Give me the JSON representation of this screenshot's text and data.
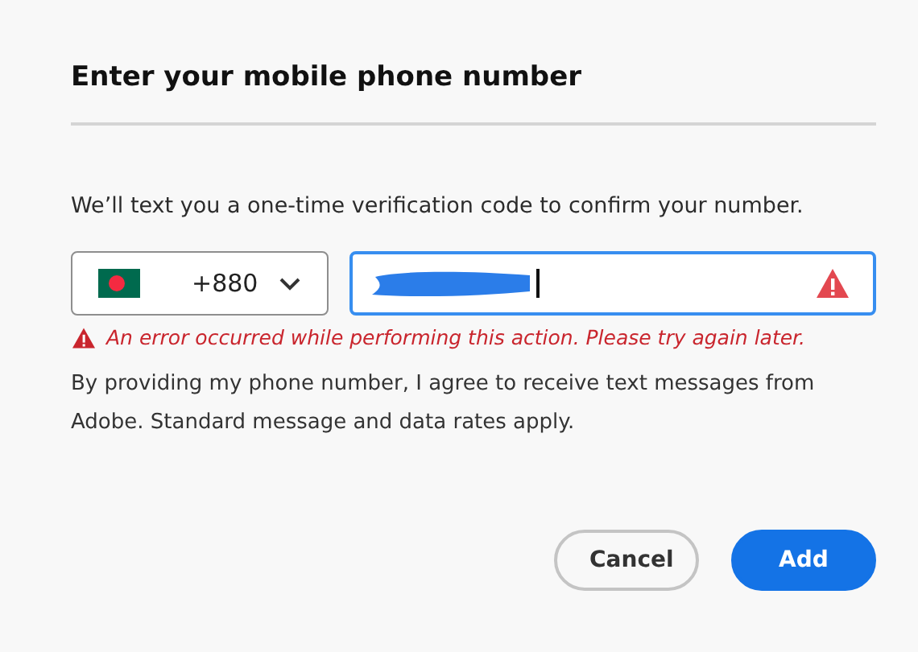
{
  "title": "Enter your mobile phone number",
  "description": "We’ll text you a one-time verification code to confirm your number.",
  "country_picker": {
    "code": "+880"
  },
  "phone_field": {
    "invalid": true,
    "focused": true
  },
  "error": "An error occurred while performing this action. Please try again later.",
  "disclaimer": "By providing my phone number, I agree to receive text messages from Adobe. Standard message and data rates apply.",
  "buttons": [
    {
      "label": "Cancel",
      "kind": "secondary"
    },
    {
      "label": "Add",
      "kind": "primary"
    }
  ]
}
